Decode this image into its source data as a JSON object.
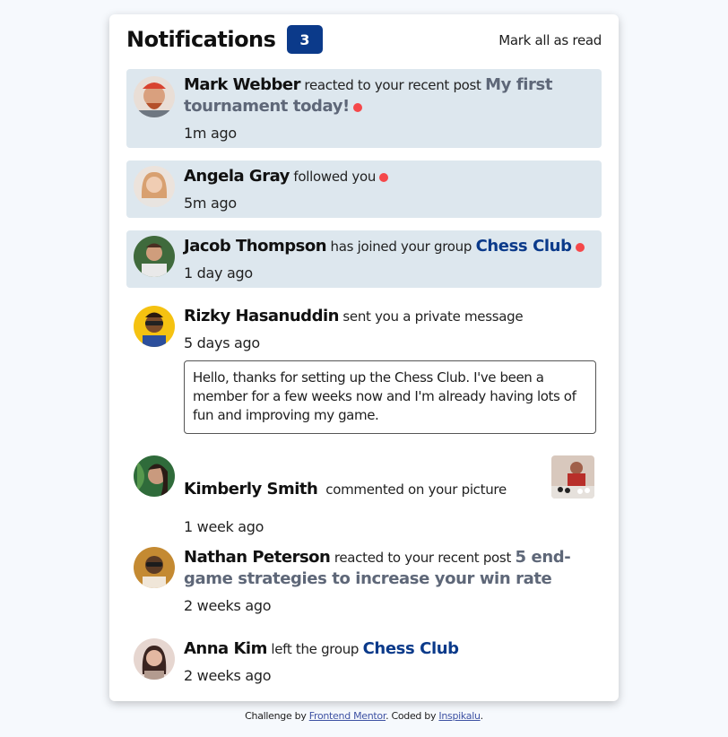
{
  "header": {
    "title": "Notifications",
    "unread_count": "3",
    "mark_all_label": "Mark all as read"
  },
  "notifications": [
    {
      "name": "Mark Webber",
      "action": "reacted to your recent post",
      "target": "My first tournament today!",
      "time": "1m ago",
      "unread": true
    },
    {
      "name": "Angela Gray",
      "action": "followed you",
      "time": "5m ago",
      "unread": true
    },
    {
      "name": "Jacob Thompson",
      "action": "has joined your group",
      "target": "Chess Club",
      "time": "1 day ago",
      "unread": true
    },
    {
      "name": "Rizky Hasanuddin",
      "action": "sent you a private message",
      "time": "5 days ago",
      "message": "Hello, thanks for setting up the Chess Club. I've been a member for a few weeks now and I'm already having lots of fun and improving my game.",
      "unread": false
    },
    {
      "name": "Kimberly Smith",
      "action": "commented on your picture",
      "time": "1 week ago",
      "unread": false
    },
    {
      "name": "Nathan Peterson",
      "action": "reacted to your recent post",
      "target": "5 end-game strategies to increase your win rate",
      "time": "2 weeks ago",
      "unread": false
    },
    {
      "name": "Anna Kim",
      "action": "left the group",
      "target": "Chess Club",
      "time": "2 weeks ago",
      "unread": false
    }
  ],
  "footer": {
    "prefix": "Challenge by",
    "link1": "Frontend Mentor",
    "middle": ". Coded by",
    "link2": "Inspikalu",
    "suffix": "."
  },
  "colors": {
    "accent": "#0b3a8a",
    "unread_bg": "#dde7ee",
    "dot": "#f5484a"
  }
}
